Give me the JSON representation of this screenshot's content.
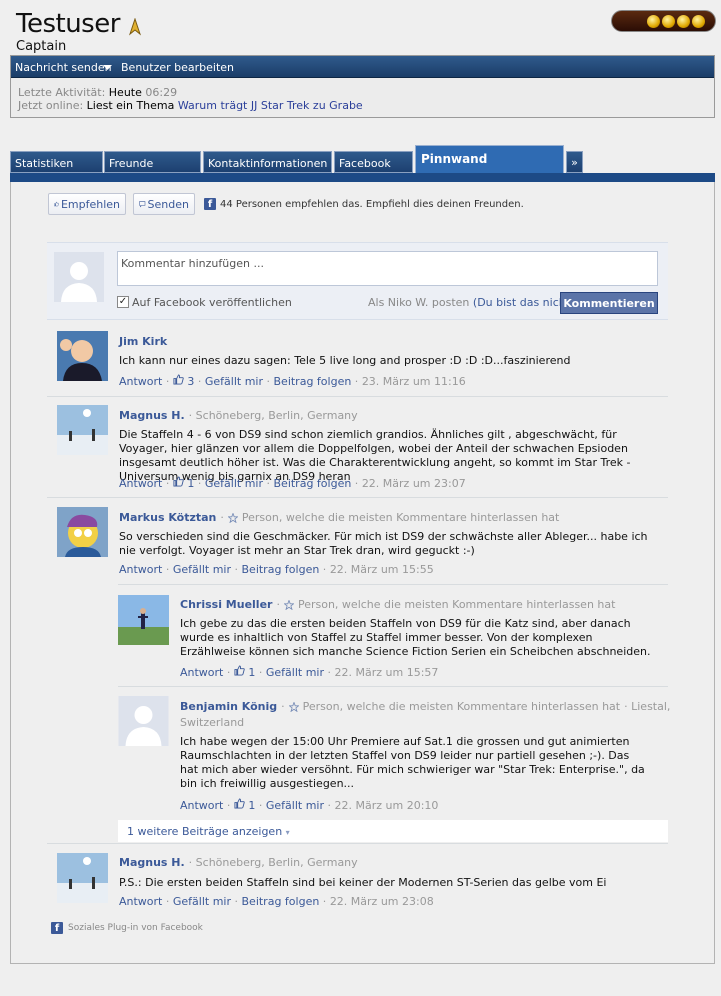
{
  "profile": {
    "username": "Testuser",
    "rank": "Captain",
    "actions": [
      "Nachricht senden",
      "Benutzer bearbeiten"
    ],
    "last_activity_label": "Letzte Aktivität:",
    "last_activity_day": "Heute",
    "last_activity_time": "06:29",
    "online_label": "Jetzt online:",
    "online_status": "Liest ein Thema",
    "online_topic": "Warum trägt JJ Star Trek zu Grabe"
  },
  "tabs": [
    "Statistiken",
    "Freunde",
    "Kontaktinformationen",
    "Facebook",
    "Pinnwand",
    "»"
  ],
  "active_tab": "Pinnwand",
  "facebook": {
    "recommend_label": "Empfehlen",
    "send_label": "Senden",
    "recommend_text": "44 Personen empfehlen das. Empfiehl dies deinen Freunden.",
    "comment_placeholder": "Kommentar hinzufügen ...",
    "publish_label": "Auf Facebook veröffentlichen",
    "post_as": "Als Niko W. posten",
    "not_you": "(Du bist das nicht?)",
    "submit_label": "Kommentieren",
    "more_replies": "1 weitere Beiträge anzeigen",
    "plugin_note": "Soziales Plug-in von Facebook",
    "action_reply": "Antwort",
    "action_like": "Gefällt mir",
    "action_follow": "Beitrag folgen"
  },
  "comments": [
    {
      "author": "Jim Kirk",
      "meta": "",
      "text": "Ich kann nur eines dazu sagen: Tele 5 live long and prosper :D :D :D...faszinierend",
      "likes": "3",
      "date": "23. März um 11:16"
    },
    {
      "author": "Magnus H.",
      "meta": "· Schöneberg, Berlin, Germany",
      "text": "Die Staffeln 4 - 6 von DS9 sind schon ziemlich grandios. Ähnliches gilt , abgeschwächt, für Voyager, hier glänzen vor allem die Doppelfolgen, wobei der Anteil der schwachen Epsioden insgesamt deutlich höher ist. Was die Charakterentwicklung angeht, so kommt im Star Trek - Universum wenig bis garnix an DS9 heran",
      "likes": "1",
      "date": "22. März um 23:07"
    },
    {
      "author": "Markus Kötztan",
      "meta": "Person, welche die meisten Kommentare hinterlassen hat",
      "text": "So verschieden sind die Geschmäcker. Für mich ist DS9 der schwächste aller Ableger... habe ich nie verfolgt. Voyager ist mehr an Star Trek dran, wird geguckt :-)",
      "likes": "",
      "date": "22. März um 15:55"
    },
    {
      "author": "Chrissi Mueller",
      "meta": "Person, welche die meisten Kommentare hinterlassen hat",
      "text": "Ich gebe zu das die ersten beiden Staffeln von DS9 für die Katz sind, aber danach wurde es inhaltlich von Staffel zu Staffel immer besser. Von der komplexen Erzählweise können sich manche Science Fiction Serien ein Scheibchen abschneiden.",
      "likes": "1",
      "date": "22. März um 15:57"
    },
    {
      "author": "Benjamin König",
      "meta": "Person, welche die meisten Kommentare hinterlassen hat",
      "location": "· Liestal,",
      "location2": "Switzerland",
      "text": "Ich habe wegen der 15:00 Uhr Premiere auf Sat.1 die grossen und gut animierten Raumschlachten in der letzten Staffel von DS9 leider nur partiell gesehen ;-). Das hat mich aber wieder versöhnt. Für mich schwieriger war \"Star Trek: Enterprise.\", da bin ich freiwillig ausgestiegen...",
      "likes": "1",
      "date": "22. März um 20:10"
    },
    {
      "author": "Magnus H.",
      "meta": "· Schöneberg, Berlin, Germany",
      "text": "P.S.: Die ersten beiden Staffeln sind bei keiner der Modernen ST-Serien das gelbe vom Ei",
      "likes": "",
      "date": "22. März um 23:08"
    }
  ],
  "colors": {
    "fb_blue": "#3b5998",
    "tab_blue": "#2f5a8c",
    "active_tab": "#2f6bb3"
  }
}
